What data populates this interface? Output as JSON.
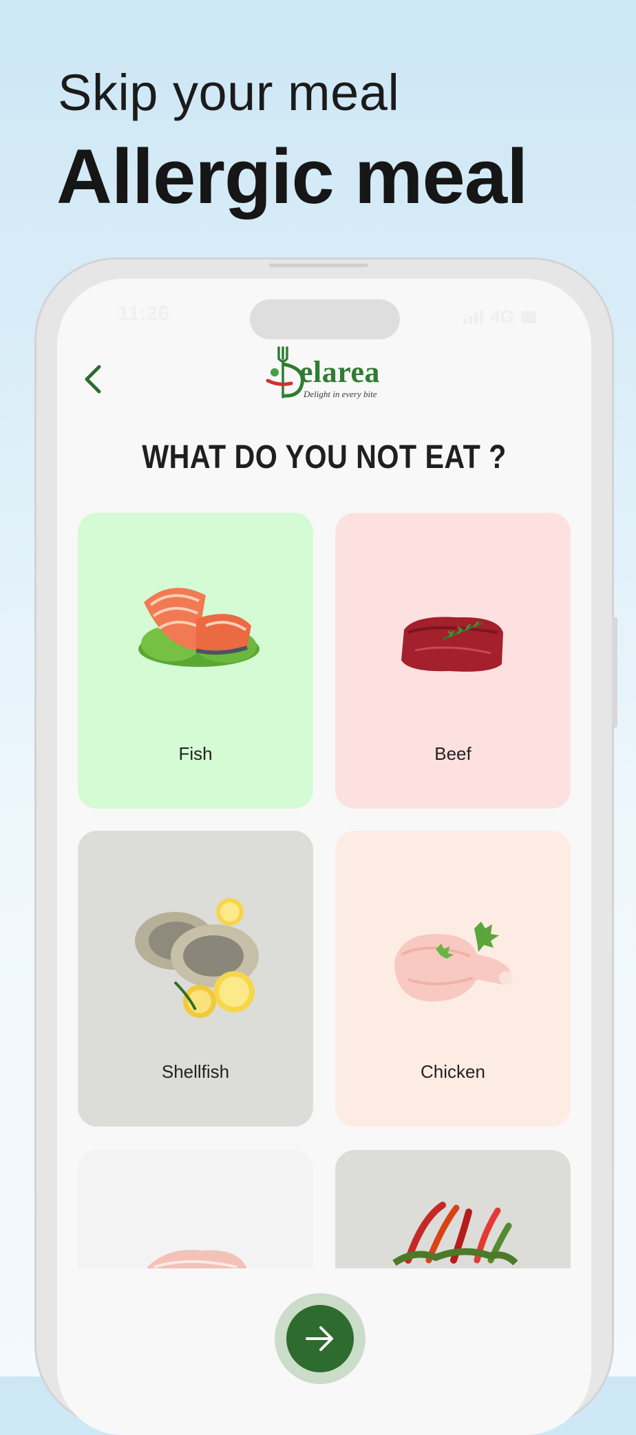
{
  "promo": {
    "line1": "Skip your meal",
    "line2": "Allergic meal"
  },
  "status_bar": {
    "time": "11:26",
    "network": "4G"
  },
  "header": {
    "logo_text": "elarea",
    "logo_tagline": "Delight in every bite",
    "back_icon": "chevron-left-icon"
  },
  "page": {
    "title": "WHAT DO YOU NOT EAT ?"
  },
  "options": [
    {
      "label": "Fish",
      "bg": "#d4fbd4"
    },
    {
      "label": "Beef",
      "bg": "#fde1e1"
    },
    {
      "label": "Shellfish",
      "bg": "#dcdcd9"
    },
    {
      "label": "Chicken",
      "bg": "#fdece4"
    },
    {
      "label": "",
      "bg": "#f3f3f3"
    },
    {
      "label": "",
      "bg": "#dcdcd8"
    }
  ],
  "next_button": {
    "icon": "arrow-right-icon"
  },
  "colors": {
    "brand_green": "#2e6b2f",
    "logo_green": "#2e7d32"
  }
}
